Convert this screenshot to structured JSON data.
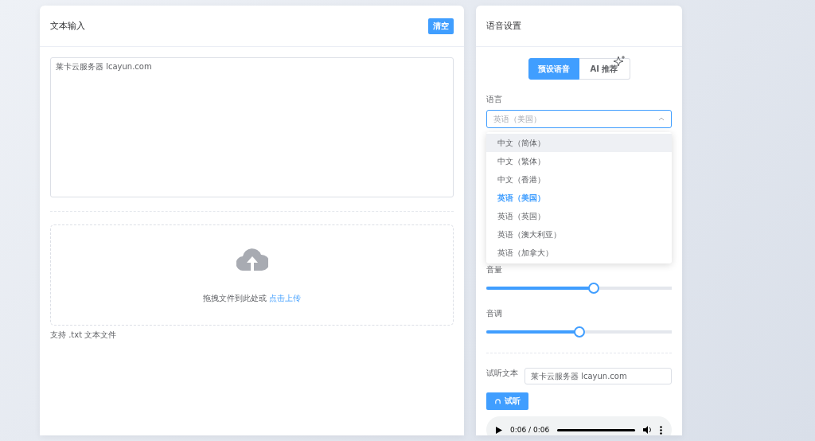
{
  "text_panel": {
    "title": "文本输入",
    "clear_button": "清空",
    "text_value": "莱卡云服务器 lcayun.com",
    "upload": {
      "prompt": "拖拽文件到此处或",
      "link": "点击上传"
    },
    "hint": "支持 .txt 文本文件"
  },
  "voice_panel": {
    "title": "语音设置",
    "tabs": [
      {
        "label": "预设语音",
        "selected": true
      },
      {
        "label": "AI 推荐",
        "selected": false
      }
    ],
    "language": {
      "label": "语言",
      "value": "英语（美国）",
      "expanded": true,
      "options": [
        {
          "label": "中文（简体）",
          "selected": false,
          "hovered": true
        },
        {
          "label": "中文（繁体）",
          "selected": false,
          "hovered": false
        },
        {
          "label": "中文（香港）",
          "selected": false,
          "hovered": false
        },
        {
          "label": "英语（美国）",
          "selected": true,
          "hovered": false
        },
        {
          "label": "英语（英国）",
          "selected": false,
          "hovered": false
        },
        {
          "label": "英语（澳大利亚）",
          "selected": false,
          "hovered": false
        },
        {
          "label": "英语（加拿大）",
          "selected": false,
          "hovered": false
        }
      ]
    },
    "sliders": [
      {
        "label": "音量",
        "level": 0.58
      },
      {
        "label": "音调",
        "level": 0.5
      }
    ],
    "preview": {
      "label": "试听文本",
      "value": "莱卡云服务器 lcayun.com",
      "button": "试听"
    },
    "player": {
      "time": "0:06 / 0:06",
      "level": 1
    }
  }
}
